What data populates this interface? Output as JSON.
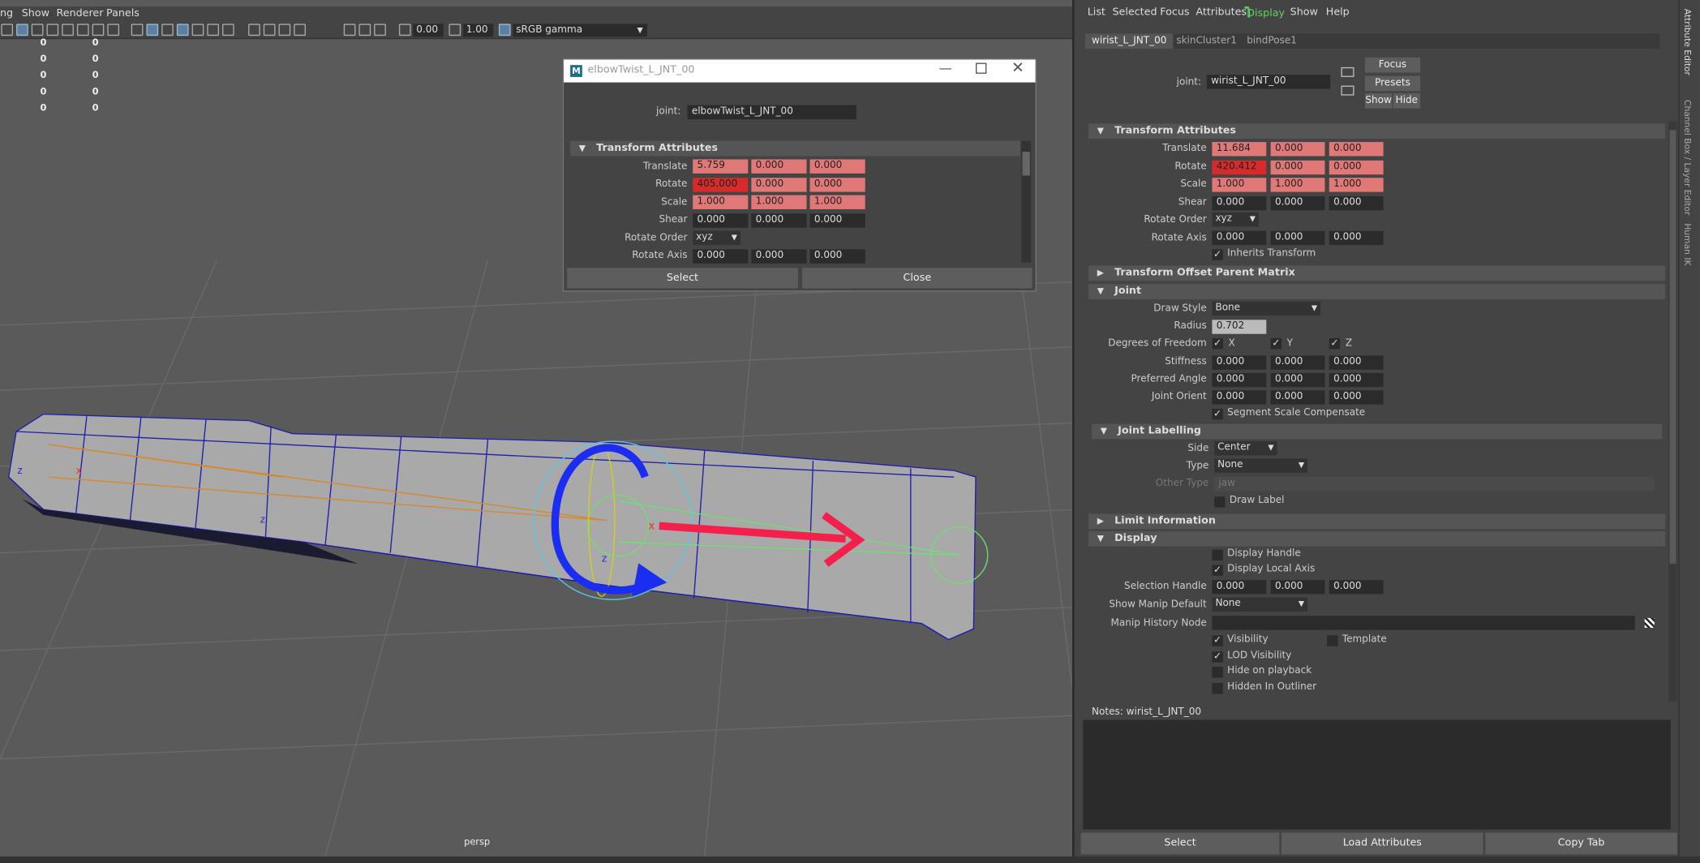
{
  "viewport": {
    "menu": [
      "ng",
      "Show",
      "Renderer",
      "Panels"
    ],
    "toolbar_values": [
      "0.00",
      "1.00"
    ],
    "color_space": "sRGB gamma",
    "hud_rows": [
      [
        "0",
        "0"
      ],
      [
        "0",
        "0"
      ],
      [
        "0",
        "0"
      ],
      [
        "0",
        "0"
      ],
      [
        "0",
        "0"
      ]
    ],
    "camera_label": "persp"
  },
  "joint_window": {
    "title": "elbowTwist_L_JNT_00",
    "joint_label": "joint:",
    "joint_value": "elbowTwist_L_JNT_00",
    "section": "Transform Attributes",
    "rows": {
      "translate": {
        "label": "Translate",
        "values": [
          "5.759",
          "0.000",
          "0.000"
        ]
      },
      "rotate": {
        "label": "Rotate",
        "values": [
          "405.000",
          "0.000",
          "0.000"
        ]
      },
      "scale": {
        "label": "Scale",
        "values": [
          "1.000",
          "1.000",
          "1.000"
        ]
      },
      "shear": {
        "label": "Shear",
        "values": [
          "0.000",
          "0.000",
          "0.000"
        ]
      },
      "rotate_order": {
        "label": "Rotate Order",
        "value": "xyz"
      },
      "rotate_axis": {
        "label": "Rotate Axis",
        "values": [
          "0.000",
          "0.000",
          "0.000"
        ]
      }
    },
    "buttons": {
      "select": "Select",
      "close": "Close"
    }
  },
  "attr_editor": {
    "menu": [
      "List",
      "Selected",
      "Focus",
      "Attributes",
      "Display",
      "Show",
      "Help"
    ],
    "tabs": [
      "wirist_L_JNT_00",
      "skinCluster1",
      "bindPose1"
    ],
    "joint_label": "joint:",
    "joint_value": "wirist_L_JNT_00",
    "side_buttons": {
      "focus": "Focus",
      "presets": "Presets",
      "show": "Show",
      "hide": "Hide"
    },
    "transform": {
      "title": "Transform Attributes",
      "translate": {
        "label": "Translate",
        "values": [
          "11.684",
          "0.000",
          "0.000"
        ]
      },
      "rotate": {
        "label": "Rotate",
        "values": [
          "420.412",
          "0.000",
          "0.000"
        ]
      },
      "scale": {
        "label": "Scale",
        "values": [
          "1.000",
          "1.000",
          "1.000"
        ]
      },
      "shear": {
        "label": "Shear",
        "values": [
          "0.000",
          "0.000",
          "0.000"
        ]
      },
      "rotate_order": {
        "label": "Rotate Order",
        "value": "xyz"
      },
      "rotate_axis": {
        "label": "Rotate Axis",
        "values": [
          "0.000",
          "0.000",
          "0.000"
        ]
      },
      "inherits": "Inherits Transform"
    },
    "offset_matrix": "Transform Offset Parent Matrix",
    "joint": {
      "title": "Joint",
      "draw_style": {
        "label": "Draw Style",
        "value": "Bone"
      },
      "radius": {
        "label": "Radius",
        "value": "0.702"
      },
      "dof": {
        "label": "Degrees of Freedom",
        "x": "X",
        "y": "Y",
        "z": "Z"
      },
      "stiffness": {
        "label": "Stiffness",
        "values": [
          "0.000",
          "0.000",
          "0.000"
        ]
      },
      "preferred": {
        "label": "Preferred Angle",
        "values": [
          "0.000",
          "0.000",
          "0.000"
        ]
      },
      "orient": {
        "label": "Joint Orient",
        "values": [
          "0.000",
          "0.000",
          "0.000"
        ]
      },
      "ssc": "Segment Scale Compensate"
    },
    "labelling": {
      "title": "Joint Labelling",
      "side": {
        "label": "Side",
        "value": "Center"
      },
      "type": {
        "label": "Type",
        "value": "None"
      },
      "other": {
        "label": "Other Type",
        "value": "jaw"
      },
      "draw_label": "Draw Label"
    },
    "limit": "Limit Information",
    "display": {
      "title": "Display",
      "handle": "Display Handle",
      "local_axis": "Display Local Axis",
      "sel_handle": {
        "label": "Selection Handle",
        "values": [
          "0.000",
          "0.000",
          "0.000"
        ]
      },
      "manip_default": {
        "label": "Show Manip Default",
        "value": "None"
      },
      "manip_history": {
        "label": "Manip History Node"
      },
      "visibility": "Visibility",
      "template": "Template",
      "lod": "LOD Visibility",
      "hide_playback": "Hide on playback",
      "hidden_outliner": "Hidden In Outliner"
    },
    "notes_label": "Notes:  wirist_L_JNT_00",
    "bottom_buttons": {
      "select": "Select",
      "load": "Load Attributes",
      "copy": "Copy Tab"
    }
  },
  "side_tabs": [
    "Attribute Editor",
    "Channel Box / Layer Editor",
    "Human IK"
  ],
  "colors": {
    "keyed": "#e07878",
    "keyed_dark": "#d72a2a",
    "display_menu": "#5fd35f",
    "arrow_red": "#f2204a",
    "arrow_blue": "#1a2df0"
  }
}
